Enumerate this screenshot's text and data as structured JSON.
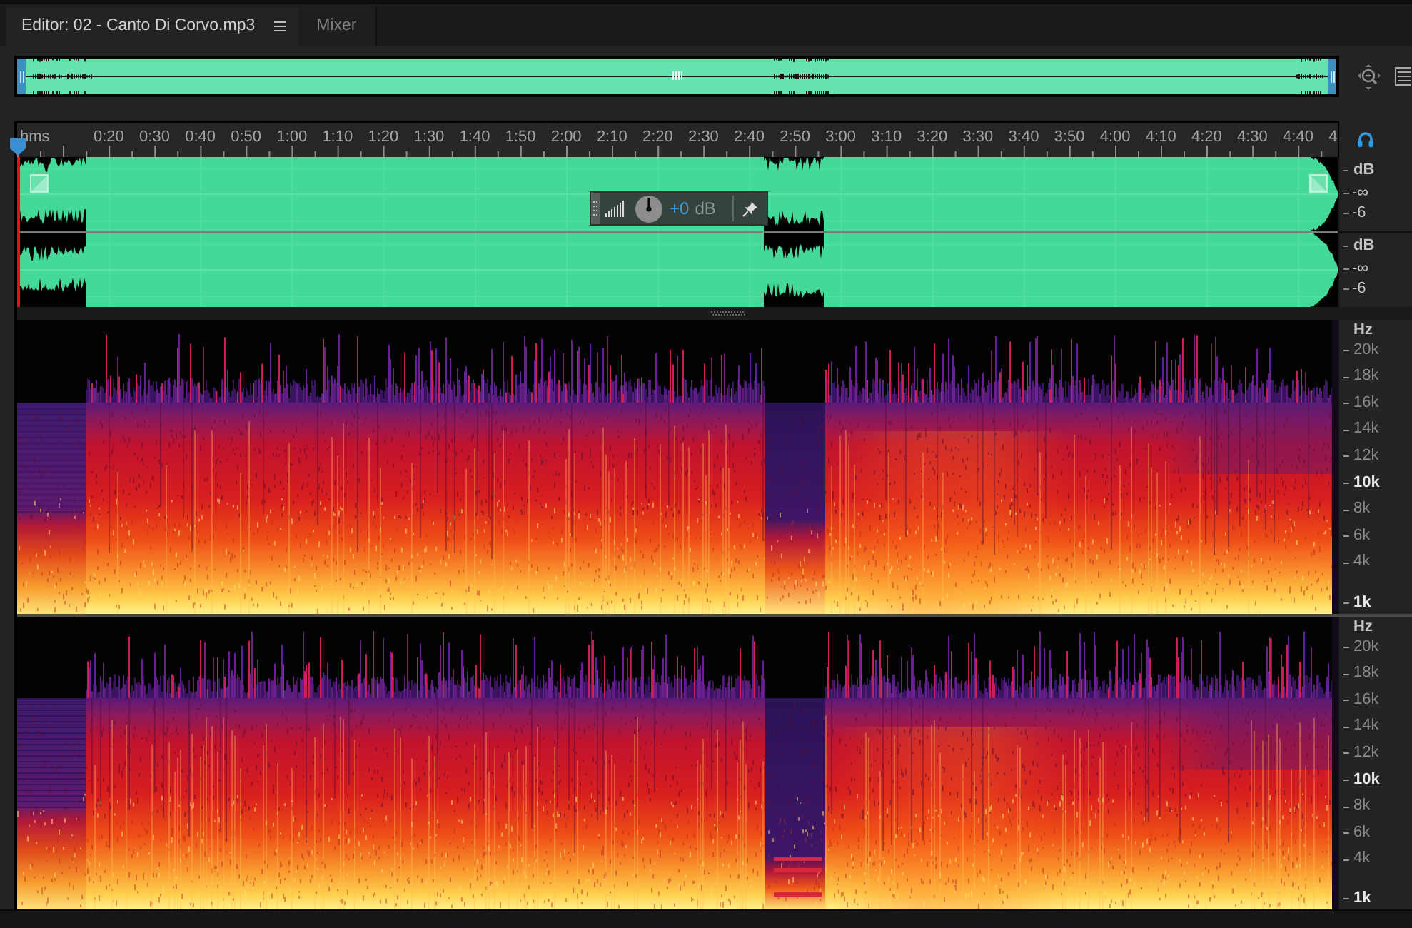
{
  "tabs": [
    {
      "label": "Editor: 02 - Canto Di Corvo.mp3",
      "selected": true
    },
    {
      "label": "Mixer",
      "selected": false
    }
  ],
  "time_ruler": {
    "unit": "hms",
    "labels": [
      "0:20",
      "0:30",
      "0:40",
      "0:50",
      "1:00",
      "1:10",
      "1:20",
      "1:30",
      "1:40",
      "1:50",
      "2:00",
      "2:10",
      "2:20",
      "2:30",
      "2:40",
      "2:50",
      "3:00",
      "3:10",
      "3:20",
      "3:30",
      "3:40",
      "3:50",
      "4:00",
      "4:10",
      "4:20",
      "4:30",
      "4:40",
      "4"
    ]
  },
  "volume_hud": {
    "value": "+0",
    "unit": "dB"
  },
  "waveform": {
    "channels": [
      {
        "unit": "dB",
        "labels": [
          "-∞",
          "-6"
        ]
      },
      {
        "unit": "dB",
        "labels": [
          "-∞",
          "-6"
        ]
      }
    ]
  },
  "spectrogram": {
    "channels": [
      {
        "unit": "Hz",
        "ticks": [
          {
            "label": "20k",
            "major": false
          },
          {
            "label": "18k",
            "major": false
          },
          {
            "label": "16k",
            "major": false
          },
          {
            "label": "14k",
            "major": false
          },
          {
            "label": "12k",
            "major": false
          },
          {
            "label": "10k",
            "major": true
          },
          {
            "label": "8k",
            "major": false
          },
          {
            "label": "6k",
            "major": false
          },
          {
            "label": "4k",
            "major": false
          },
          {
            "label": "1k",
            "major": true
          }
        ]
      },
      {
        "unit": "Hz",
        "ticks": [
          {
            "label": "20k",
            "major": false
          },
          {
            "label": "18k",
            "major": false
          },
          {
            "label": "16k",
            "major": false
          },
          {
            "label": "14k",
            "major": false
          },
          {
            "label": "12k",
            "major": false
          },
          {
            "label": "10k",
            "major": true
          },
          {
            "label": "8k",
            "major": false
          },
          {
            "label": "6k",
            "major": false
          },
          {
            "label": "4k",
            "major": false
          },
          {
            "label": "1k",
            "major": true
          }
        ]
      }
    ]
  }
}
